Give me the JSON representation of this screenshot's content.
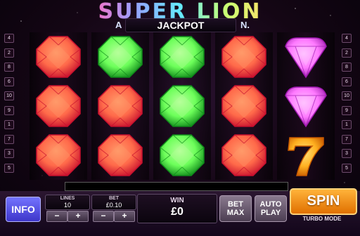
{
  "game": {
    "title": "SUPER LION",
    "jackpot_label": "JACKPOT",
    "jackpot_left_fragment": "A",
    "jackpot_right_fragment": "N."
  },
  "paylines": {
    "left": [
      "4",
      "2",
      "8",
      "6",
      "10",
      "9",
      "1",
      "7",
      "3",
      "5"
    ],
    "right": [
      "4",
      "2",
      "8",
      "6",
      "10",
      "9",
      "1",
      "7",
      "3",
      "5"
    ]
  },
  "reels": [
    [
      "red-gem",
      "red-gem",
      "red-gem"
    ],
    [
      "green-gem",
      "red-gem",
      "red-gem"
    ],
    [
      "green-gem",
      "green-gem",
      "green-gem"
    ],
    [
      "red-gem",
      "red-gem",
      "red-gem"
    ],
    [
      "purple-gem",
      "purple-gem",
      "seven-symbol"
    ]
  ],
  "symbol_colors": {
    "red-gem": [
      "#ff6a4a",
      "#c8102e",
      "#ff9a6a"
    ],
    "green-gem": [
      "#6dff5a",
      "#0f8a1a",
      "#b6ff9a"
    ],
    "purple-gem": [
      "#ff7aff",
      "#a01ab0",
      "#ffc2ff"
    ],
    "seven-symbol": [
      "#ffb020",
      "#c85a00",
      "#ffe27a"
    ]
  },
  "controls": {
    "info_label": "INFO",
    "lines_label": "LINES",
    "lines_value": "10",
    "bet_label": "BET",
    "bet_value": "£0.10",
    "minus": "−",
    "plus": "+",
    "win_label": "WIN",
    "win_value": "£0",
    "bet_max_label": "BET\nMAX",
    "auto_play_label": "AUTO\nPLAY",
    "spin_label": "SPIN",
    "turbo_label": "TURBO MODE"
  },
  "colors": {
    "accent_spin": "#f08a10",
    "info_button": "#5a52e8"
  }
}
